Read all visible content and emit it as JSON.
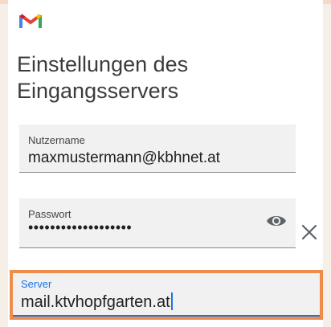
{
  "app": {
    "logo_icon": "gmail-logo-icon"
  },
  "page": {
    "title": "Einstellungen des Eingangsservers"
  },
  "fields": {
    "username": {
      "label": "Nutzername",
      "value": "maxmustermann@kbhnet.at"
    },
    "password": {
      "label": "Passwort",
      "value": "•••••••••••••••••••",
      "toggle_icon": "eye-icon"
    },
    "server": {
      "label": "Server",
      "value": "mail.ktvhopfgarten.at",
      "accent_color": "#1a73e8"
    }
  },
  "actions": {
    "clear_icon": "close-icon"
  },
  "colors": {
    "highlight": "#ee8c4b",
    "background": "#f6efe8"
  }
}
